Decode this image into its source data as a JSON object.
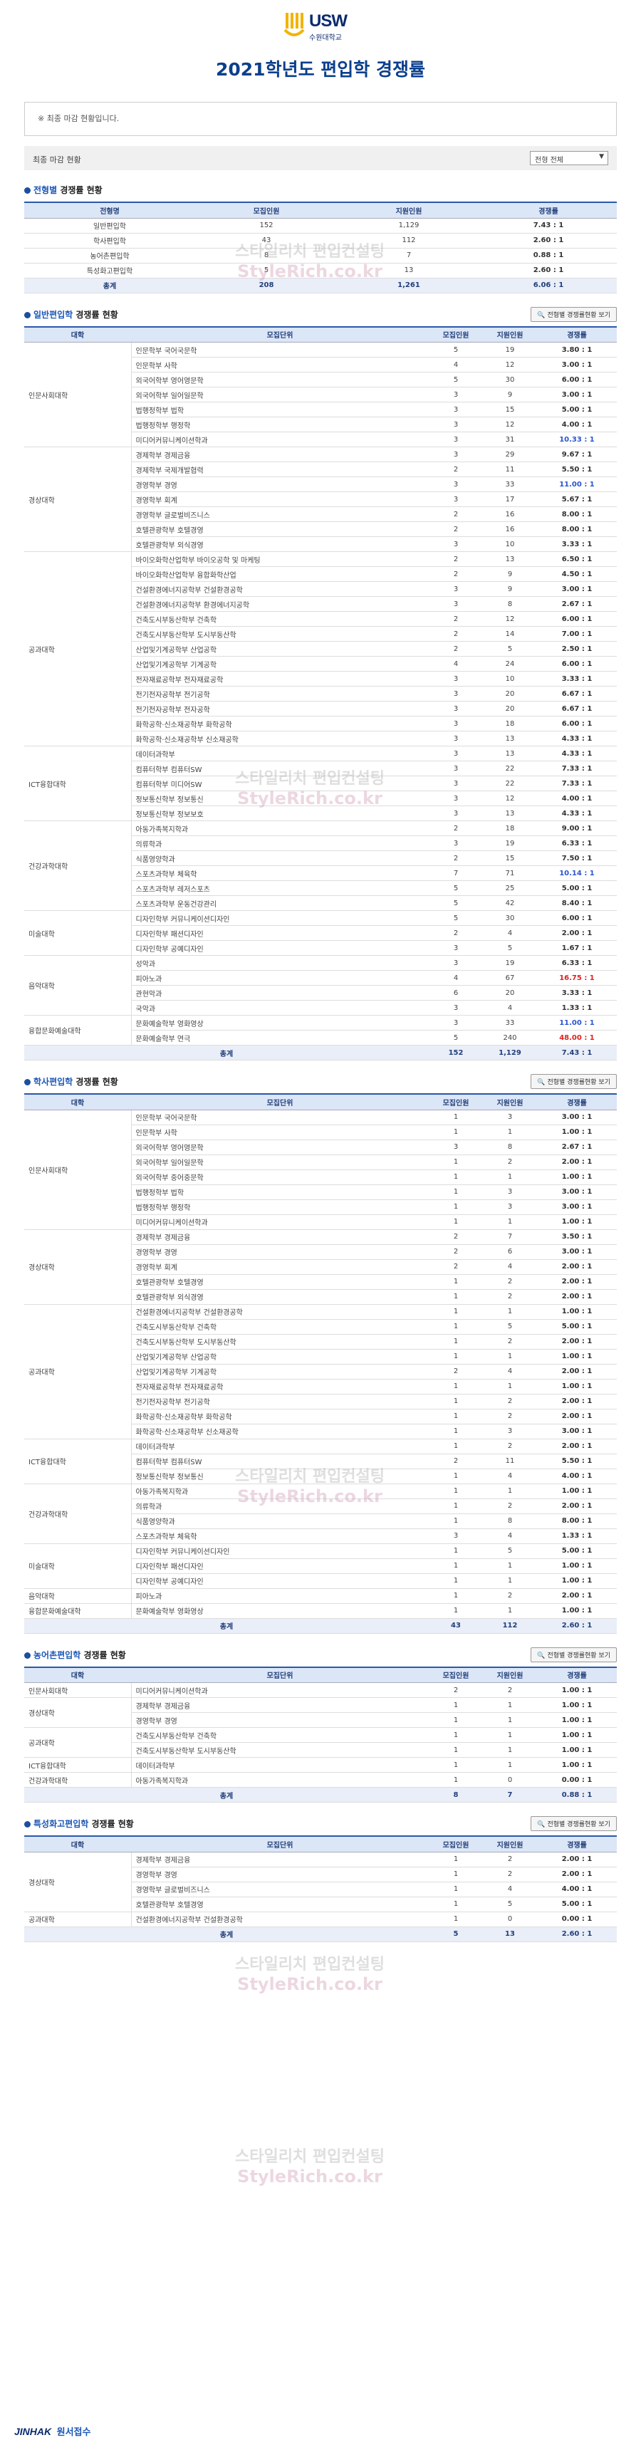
{
  "header": {
    "logo_text": "USW",
    "logo_sub": "수원대학교",
    "title": "2021학년도 편입학 경쟁률"
  },
  "notice": "※ 최종 마감 현황입니다.",
  "filter": {
    "label": "최종 마감 현황",
    "select_value": "전형 전체"
  },
  "watermark": {
    "line1": "스타일리치 편입컨설팅",
    "line2": "StyleRich.co.kr"
  },
  "summary": {
    "title_hl": "전형별",
    "title_rest": "경쟁률 현황",
    "headers": [
      "전형명",
      "모집인원",
      "지원인원",
      "경쟁률"
    ],
    "rows": [
      [
        "일반편입학",
        "152",
        "1,129",
        "7.43 : 1"
      ],
      [
        "학사편입학",
        "43",
        "112",
        "2.60 : 1"
      ],
      [
        "농어촌편입학",
        "8",
        "7",
        "0.88 : 1"
      ],
      [
        "특성화고편입학",
        "5",
        "13",
        "2.60 : 1"
      ]
    ],
    "total": [
      "총계",
      "208",
      "1,261",
      "6.06 : 1"
    ]
  },
  "general": {
    "title_hl": "일반편입학",
    "title_rest": "경쟁률 현황",
    "btn": "전형별 경쟁률현황 보기",
    "headers": [
      "대학",
      "모집단위",
      "모집인원",
      "지원인원",
      "경쟁률"
    ],
    "groups": [
      {
        "college": "인문사회대학",
        "rows": [
          [
            "인문학부 국어국문학",
            "5",
            "19",
            "3.80 : 1"
          ],
          [
            "인문학부 사학",
            "4",
            "12",
            "3.00 : 1"
          ],
          [
            "외국어학부 영어영문학",
            "5",
            "30",
            "6.00 : 1"
          ],
          [
            "외국어학부 일어일문학",
            "3",
            "9",
            "3.00 : 1"
          ],
          [
            "법행정학부 법학",
            "3",
            "15",
            "5.00 : 1"
          ],
          [
            "법행정학부 행정학",
            "3",
            "12",
            "4.00 : 1"
          ],
          [
            "미디어커뮤니케이션학과",
            "3",
            "31",
            "10.33 : 1"
          ]
        ]
      },
      {
        "college": "경상대학",
        "rows": [
          [
            "경제학부 경제금융",
            "3",
            "29",
            "9.67 : 1"
          ],
          [
            "경제학부 국제개발협력",
            "2",
            "11",
            "5.50 : 1"
          ],
          [
            "경영학부 경영",
            "3",
            "33",
            "11.00 : 1"
          ],
          [
            "경영학부 회계",
            "3",
            "17",
            "5.67 : 1"
          ],
          [
            "경영학부 글로벌비즈니스",
            "2",
            "16",
            "8.00 : 1"
          ],
          [
            "호텔관광학부 호텔경영",
            "2",
            "16",
            "8.00 : 1"
          ],
          [
            "호텔관광학부 외식경영",
            "3",
            "10",
            "3.33 : 1"
          ]
        ]
      },
      {
        "college": "공과대학",
        "rows": [
          [
            "바이오화학산업학부 바이오공학 및 마케팅",
            "2",
            "13",
            "6.50 : 1"
          ],
          [
            "바이오화학산업학부 융합화학산업",
            "2",
            "9",
            "4.50 : 1"
          ],
          [
            "건설환경에너지공학부 건설환경공학",
            "3",
            "9",
            "3.00 : 1"
          ],
          [
            "건설환경에너지공학부 환경에너지공학",
            "3",
            "8",
            "2.67 : 1"
          ],
          [
            "건축도시부동산학부 건축학",
            "2",
            "12",
            "6.00 : 1"
          ],
          [
            "건축도시부동산학부 도시부동산학",
            "2",
            "14",
            "7.00 : 1"
          ],
          [
            "산업및기계공학부 산업공학",
            "2",
            "5",
            "2.50 : 1"
          ],
          [
            "산업및기계공학부 기계공학",
            "4",
            "24",
            "6.00 : 1"
          ],
          [
            "전자재료공학부 전자재료공학",
            "3",
            "10",
            "3.33 : 1"
          ],
          [
            "전기전자공학부 전기공학",
            "3",
            "20",
            "6.67 : 1"
          ],
          [
            "전기전자공학부 전자공학",
            "3",
            "20",
            "6.67 : 1"
          ],
          [
            "화학공학·신소재공학부 화학공학",
            "3",
            "18",
            "6.00 : 1"
          ],
          [
            "화학공학·신소재공학부 신소재공학",
            "3",
            "13",
            "4.33 : 1"
          ]
        ]
      },
      {
        "college": "ICT융합대학",
        "rows": [
          [
            "데이터과학부",
            "3",
            "13",
            "4.33 : 1"
          ],
          [
            "컴퓨터학부 컴퓨터SW",
            "3",
            "22",
            "7.33 : 1"
          ],
          [
            "컴퓨터학부 미디어SW",
            "3",
            "22",
            "7.33 : 1"
          ],
          [
            "정보통신학부 정보통신",
            "3",
            "12",
            "4.00 : 1"
          ],
          [
            "정보통신학부 정보보호",
            "3",
            "13",
            "4.33 : 1"
          ]
        ]
      },
      {
        "college": "건강과학대학",
        "rows": [
          [
            "아동가족복지학과",
            "2",
            "18",
            "9.00 : 1"
          ],
          [
            "의류학과",
            "3",
            "19",
            "6.33 : 1"
          ],
          [
            "식품영양학과",
            "2",
            "15",
            "7.50 : 1"
          ],
          [
            "스포츠과학부 체육학",
            "7",
            "71",
            "10.14 : 1"
          ],
          [
            "스포츠과학부 레저스포츠",
            "5",
            "25",
            "5.00 : 1"
          ],
          [
            "스포츠과학부 운동건강관리",
            "5",
            "42",
            "8.40 : 1"
          ]
        ]
      },
      {
        "college": "미술대학",
        "rows": [
          [
            "디자인학부 커뮤니케이션디자인",
            "5",
            "30",
            "6.00 : 1"
          ],
          [
            "디자인학부 패션디자인",
            "2",
            "4",
            "2.00 : 1"
          ],
          [
            "디자인학부 공예디자인",
            "3",
            "5",
            "1.67 : 1"
          ]
        ]
      },
      {
        "college": "음악대학",
        "rows": [
          [
            "성악과",
            "3",
            "19",
            "6.33 : 1"
          ],
          [
            "피아노과",
            "4",
            "67",
            "16.75 : 1"
          ],
          [
            "관현악과",
            "6",
            "20",
            "3.33 : 1"
          ],
          [
            "국악과",
            "3",
            "4",
            "1.33 : 1"
          ]
        ]
      },
      {
        "college": "융합문화예술대학",
        "rows": [
          [
            "문화예술학부 영화영상",
            "3",
            "33",
            "11.00 : 1"
          ],
          [
            "문화예술학부 연극",
            "5",
            "240",
            "48.00 : 1"
          ]
        ]
      }
    ],
    "total": [
      "총계",
      "152",
      "1,129",
      "7.43 : 1"
    ]
  },
  "bachelor": {
    "title_hl": "학사편입학",
    "title_rest": "경쟁률 현황",
    "btn": "전형별 경쟁률현황 보기",
    "headers": [
      "대학",
      "모집단위",
      "모집인원",
      "지원인원",
      "경쟁률"
    ],
    "groups": [
      {
        "college": "인문사회대학",
        "rows": [
          [
            "인문학부 국어국문학",
            "1",
            "3",
            "3.00 : 1"
          ],
          [
            "인문학부 사학",
            "1",
            "1",
            "1.00 : 1"
          ],
          [
            "외국어학부 영어영문학",
            "3",
            "8",
            "2.67 : 1"
          ],
          [
            "외국어학부 일어일문학",
            "1",
            "2",
            "2.00 : 1"
          ],
          [
            "외국어학부 중어중문학",
            "1",
            "1",
            "1.00 : 1"
          ],
          [
            "법행정학부 법학",
            "1",
            "3",
            "3.00 : 1"
          ],
          [
            "법행정학부 행정학",
            "1",
            "3",
            "3.00 : 1"
          ],
          [
            "미디어커뮤니케이션학과",
            "1",
            "1",
            "1.00 : 1"
          ]
        ]
      },
      {
        "college": "경상대학",
        "rows": [
          [
            "경제학부 경제금융",
            "2",
            "7",
            "3.50 : 1"
          ],
          [
            "경영학부 경영",
            "2",
            "6",
            "3.00 : 1"
          ],
          [
            "경영학부 회계",
            "2",
            "4",
            "2.00 : 1"
          ],
          [
            "호텔관광학부 호텔경영",
            "1",
            "2",
            "2.00 : 1"
          ],
          [
            "호텔관광학부 외식경영",
            "1",
            "2",
            "2.00 : 1"
          ]
        ]
      },
      {
        "college": "공과대학",
        "rows": [
          [
            "건설환경에너지공학부 건설환경공학",
            "1",
            "1",
            "1.00 : 1"
          ],
          [
            "건축도시부동산학부 건축학",
            "1",
            "5",
            "5.00 : 1"
          ],
          [
            "건축도시부동산학부 도시부동산학",
            "1",
            "2",
            "2.00 : 1"
          ],
          [
            "산업및기계공학부 산업공학",
            "1",
            "1",
            "1.00 : 1"
          ],
          [
            "산업및기계공학부 기계공학",
            "2",
            "4",
            "2.00 : 1"
          ],
          [
            "전자재료공학부 전자재료공학",
            "1",
            "1",
            "1.00 : 1"
          ],
          [
            "전기전자공학부 전기공학",
            "1",
            "2",
            "2.00 : 1"
          ],
          [
            "화학공학·신소재공학부 화학공학",
            "1",
            "2",
            "2.00 : 1"
          ],
          [
            "화학공학·신소재공학부 신소재공학",
            "1",
            "3",
            "3.00 : 1"
          ]
        ]
      },
      {
        "college": "ICT융합대학",
        "rows": [
          [
            "데이터과학부",
            "1",
            "2",
            "2.00 : 1"
          ],
          [
            "컴퓨터학부 컴퓨터SW",
            "2",
            "11",
            "5.50 : 1"
          ],
          [
            "정보통신학부 정보통신",
            "1",
            "4",
            "4.00 : 1"
          ]
        ]
      },
      {
        "college": "건강과학대학",
        "rows": [
          [
            "아동가족복지학과",
            "1",
            "1",
            "1.00 : 1"
          ],
          [
            "의류학과",
            "1",
            "2",
            "2.00 : 1"
          ],
          [
            "식품영양학과",
            "1",
            "8",
            "8.00 : 1"
          ],
          [
            "스포츠과학부 체육학",
            "3",
            "4",
            "1.33 : 1"
          ]
        ]
      },
      {
        "college": "미술대학",
        "rows": [
          [
            "디자인학부 커뮤니케이션디자인",
            "1",
            "5",
            "5.00 : 1"
          ],
          [
            "디자인학부 패션디자인",
            "1",
            "1",
            "1.00 : 1"
          ],
          [
            "디자인학부 공예디자인",
            "1",
            "1",
            "1.00 : 1"
          ]
        ]
      },
      {
        "college": "음악대학",
        "rows": [
          [
            "피아노과",
            "1",
            "2",
            "2.00 : 1"
          ]
        ]
      },
      {
        "college": "융합문화예술대학",
        "rows": [
          [
            "문화예술학부 영화영상",
            "1",
            "1",
            "1.00 : 1"
          ]
        ]
      }
    ],
    "total": [
      "총계",
      "43",
      "112",
      "2.60 : 1"
    ]
  },
  "rural": {
    "title_hl": "농어촌편입학",
    "title_rest": "경쟁률 현황",
    "btn": "전형별 경쟁률현황 보기",
    "headers": [
      "대학",
      "모집단위",
      "모집인원",
      "지원인원",
      "경쟁률"
    ],
    "groups": [
      {
        "college": "인문사회대학",
        "rows": [
          [
            "미디어커뮤니케이션학과",
            "2",
            "2",
            "1.00 : 1"
          ]
        ]
      },
      {
        "college": "경상대학",
        "rows": [
          [
            "경제학부 경제금융",
            "1",
            "1",
            "1.00 : 1"
          ],
          [
            "경영학부 경영",
            "1",
            "1",
            "1.00 : 1"
          ]
        ]
      },
      {
        "college": "공과대학",
        "rows": [
          [
            "건축도시부동산학부 건축학",
            "1",
            "1",
            "1.00 : 1"
          ],
          [
            "건축도시부동산학부 도시부동산학",
            "1",
            "1",
            "1.00 : 1"
          ]
        ]
      },
      {
        "college": "ICT융합대학",
        "rows": [
          [
            "데이터과학부",
            "1",
            "1",
            "1.00 : 1"
          ]
        ]
      },
      {
        "college": "건강과학대학",
        "rows": [
          [
            "아동가족복지학과",
            "1",
            "0",
            "0.00 : 1"
          ]
        ]
      }
    ],
    "total": [
      "총계",
      "8",
      "7",
      "0.88 : 1"
    ]
  },
  "vocational": {
    "title_hl": "특성화고편입학",
    "title_rest": "경쟁률 현황",
    "btn": "전형별 경쟁률현황 보기",
    "headers": [
      "대학",
      "모집단위",
      "모집인원",
      "지원인원",
      "경쟁률"
    ],
    "groups": [
      {
        "college": "경상대학",
        "rows": [
          [
            "경제학부 경제금융",
            "1",
            "2",
            "2.00 : 1"
          ],
          [
            "경영학부 경영",
            "1",
            "2",
            "2.00 : 1"
          ],
          [
            "경영학부 글로벌비즈니스",
            "1",
            "4",
            "4.00 : 1"
          ],
          [
            "호텔관광학부 호텔경영",
            "1",
            "5",
            "5.00 : 1"
          ]
        ]
      },
      {
        "college": "공과대학",
        "rows": [
          [
            "건설환경에너지공학부 건설환경공학",
            "1",
            "0",
            "0.00 : 1"
          ]
        ]
      }
    ],
    "total": [
      "총계",
      "5",
      "13",
      "2.60 : 1"
    ]
  },
  "footer": {
    "brand": "JINHAK",
    "brand2": "원서접수"
  }
}
